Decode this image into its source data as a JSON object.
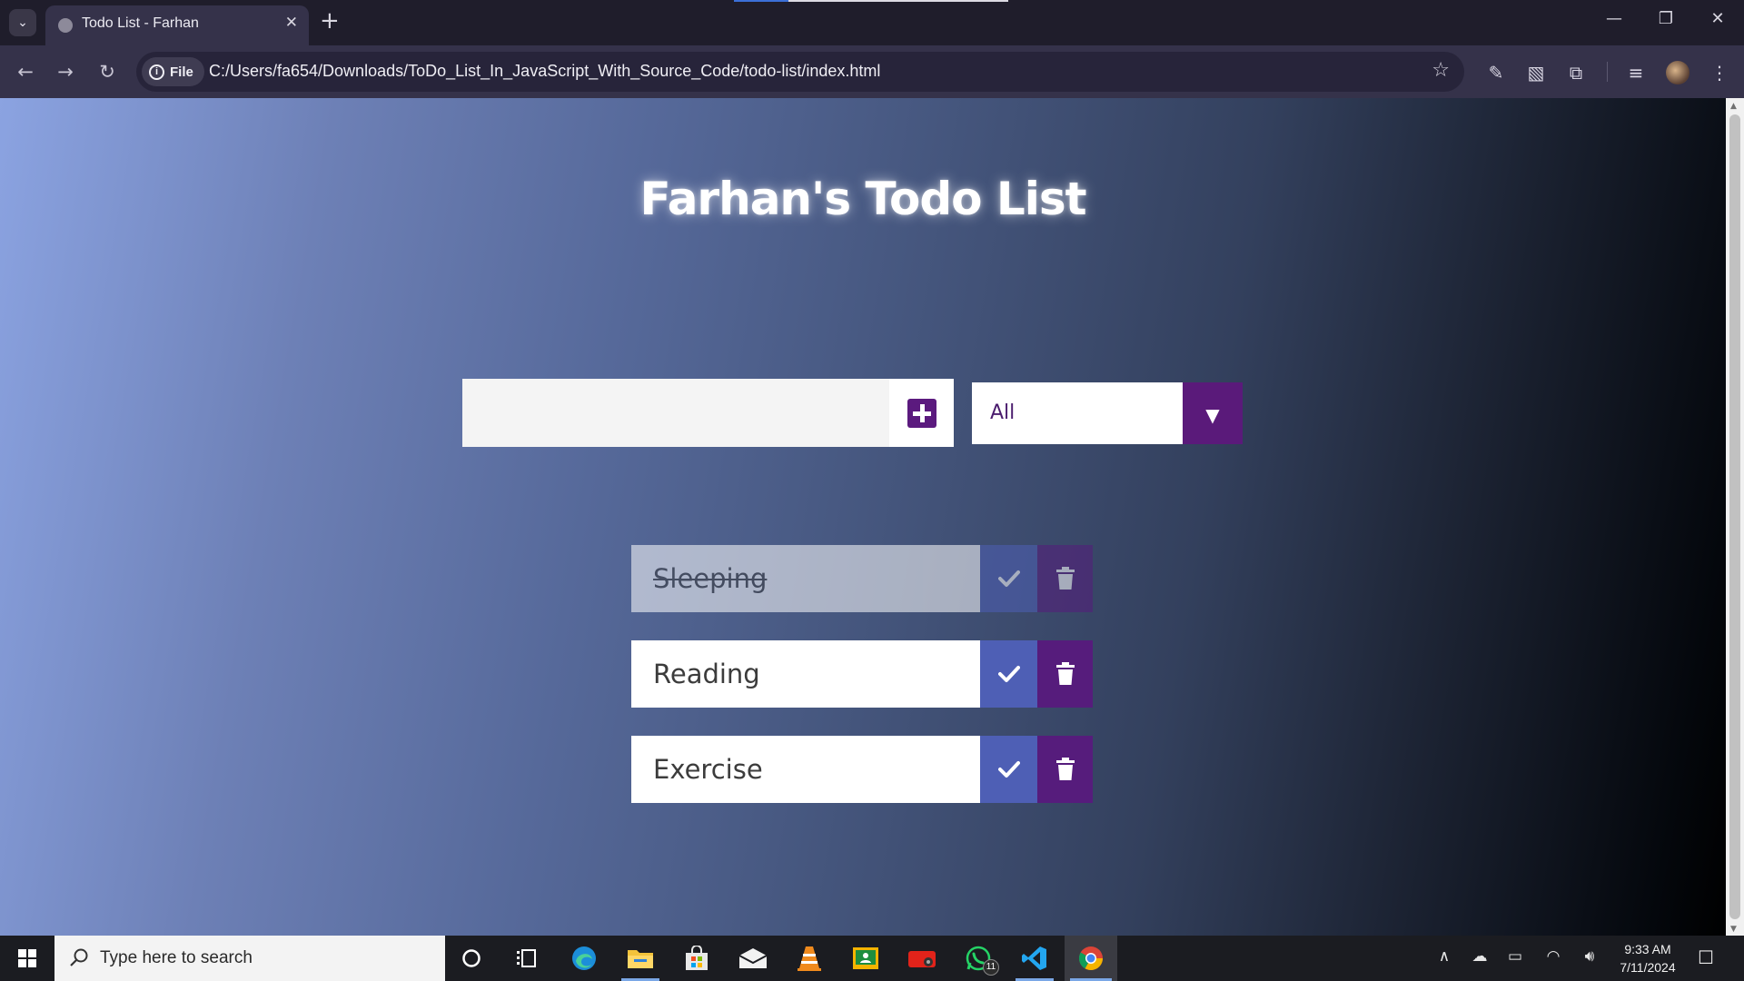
{
  "browser": {
    "tab_title": "Todo List - Farhan",
    "address_scheme_label": "File",
    "url": "C:/Users/fa654/Downloads/ToDo_List_In_JavaScript_With_Source_Code/todo-list/index.html"
  },
  "page": {
    "title": "Farhan's Todo List",
    "input_value": "",
    "filter": {
      "selected": "All"
    },
    "todos": [
      {
        "text": "Sleeping",
        "completed": true
      },
      {
        "text": "Reading",
        "completed": false
      },
      {
        "text": "Exercise",
        "completed": false
      }
    ]
  },
  "taskbar": {
    "search_placeholder": "Type here to search",
    "whatsapp_badge": "11",
    "time": "9:33 AM",
    "date": "7/11/2024"
  },
  "colors": {
    "accent_purple": "#561c7c",
    "check_blue": "#4e5fb5"
  }
}
